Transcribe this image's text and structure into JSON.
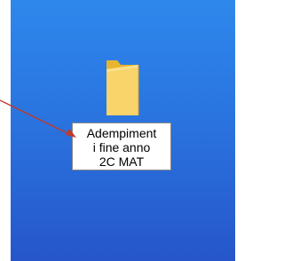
{
  "desktop": {
    "background_colors": [
      "#2e88ec",
      "#2656c9"
    ],
    "icon": {
      "type": "folder-icon",
      "color": "#f5c542",
      "label_lines": [
        "Adempiment",
        "i fine anno",
        "2C MAT"
      ]
    }
  },
  "annotation": {
    "arrow_color": "#c0392b"
  }
}
